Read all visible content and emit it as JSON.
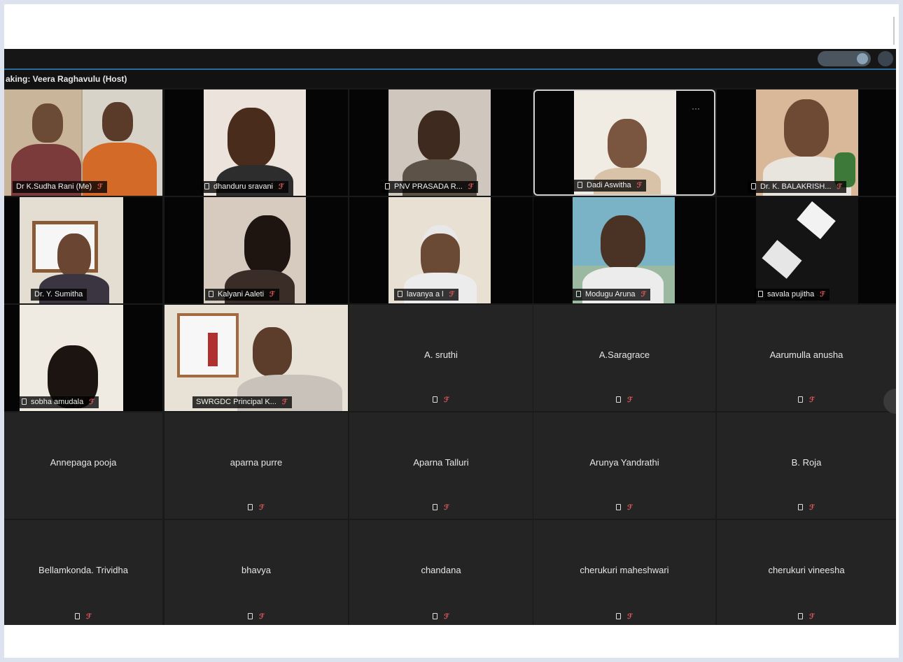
{
  "meeting": {
    "speaking_label": "aking: Veera Raghavulu (Host)"
  },
  "icons": {
    "video_icon": "camera-icon",
    "mute_icon": "muted-mic-icon",
    "more": "···"
  },
  "colors": {
    "window_bg": "#1a1a1a",
    "tile_bg": "#242424",
    "active_border": "#cfcfcf",
    "accent_line": "#2d6b9a",
    "muted_red": "#e25a5a"
  },
  "video_tiles": [
    {
      "name": "Dr K.Sudha Rani  (Me)"
    },
    {
      "name": "dhanduru sravani"
    },
    {
      "name": "PNV PRASADA R..."
    },
    {
      "name": "Dadi Aswitha"
    },
    {
      "name": "Dr. K. BALAKRISH..."
    },
    {
      "name": "Dr. Y. Sumitha"
    },
    {
      "name": "Kalyani Aaleti"
    },
    {
      "name": "lavanya a l"
    },
    {
      "name": "Modugu Aruna"
    },
    {
      "name": "savala pujitha"
    },
    {
      "name": "sobha amudala"
    },
    {
      "name": "SWRGDC Principal K..."
    }
  ],
  "name_tiles": [
    {
      "name": "A. sruthi"
    },
    {
      "name": "A.Saragrace"
    },
    {
      "name": "Aarumulla anusha"
    },
    {
      "name": "Annepaga pooja"
    },
    {
      "name": "aparna purre"
    },
    {
      "name": "Aparna Talluri"
    },
    {
      "name": "Arunya Yandrathi"
    },
    {
      "name": "B. Roja"
    },
    {
      "name": "Bellamkonda. Trividha"
    },
    {
      "name": "bhavya"
    },
    {
      "name": "chandana"
    },
    {
      "name": "cherukuri maheshwari"
    },
    {
      "name": "cherukuri vineesha"
    }
  ]
}
